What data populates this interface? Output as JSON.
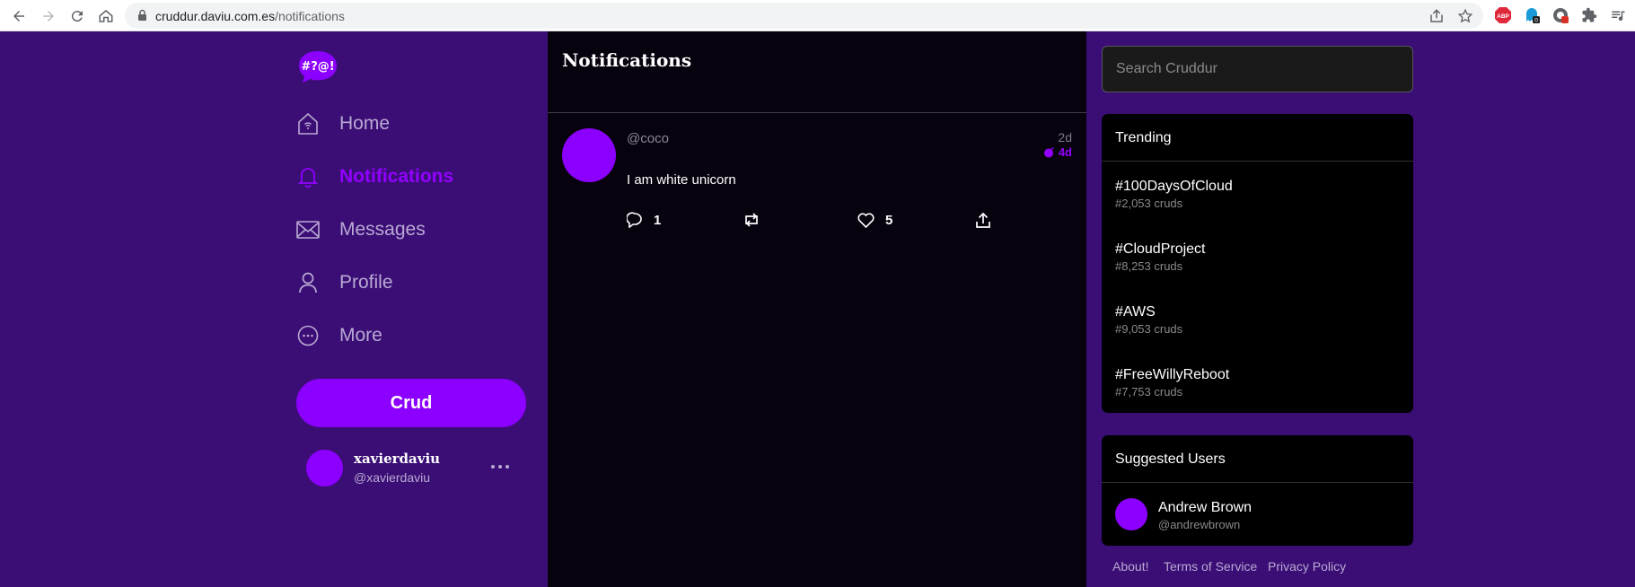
{
  "browser": {
    "url_host": "cruddur.daviu.com.es",
    "url_path": "/notifications",
    "extension_badge": "0"
  },
  "logo_text": "#?@!",
  "nav": [
    {
      "label": "Home",
      "icon": "home-icon"
    },
    {
      "label": "Notifications",
      "icon": "bell-icon"
    },
    {
      "label": "Messages",
      "icon": "envelope-icon"
    },
    {
      "label": "Profile",
      "icon": "person-icon"
    },
    {
      "label": "More",
      "icon": "more-circle-icon"
    }
  ],
  "crud_button": "Crud",
  "current_user": {
    "name": "xavierdaviu",
    "handle": "@xavierdaviu"
  },
  "feed": {
    "title": "Notifications",
    "post": {
      "handle": "@coco",
      "time": "2d",
      "expires": "4d",
      "message": "I am white unicorn",
      "replies": "1",
      "likes": "5"
    }
  },
  "search": {
    "placeholder": "Search Cruddur"
  },
  "trending": {
    "title": "Trending",
    "items": [
      {
        "name": "#100DaysOfCloud",
        "count": "#2,053 cruds"
      },
      {
        "name": "#CloudProject",
        "count": "#8,253 cruds"
      },
      {
        "name": "#AWS",
        "count": "#9,053 cruds"
      },
      {
        "name": "#FreeWillyReboot",
        "count": "#7,753 cruds"
      }
    ]
  },
  "suggested": {
    "title": "Suggested Users",
    "user": {
      "name": "Andrew Brown",
      "handle": "@andrewbrown"
    }
  },
  "footer": {
    "about": "About!",
    "terms": "Terms of Service",
    "privacy": "Privacy Policy"
  },
  "colors": {
    "brand_purple": "#8c00ff",
    "page_background": "#3b0e75",
    "feed_background": "#08020e",
    "active_nav": "#9200ff"
  }
}
